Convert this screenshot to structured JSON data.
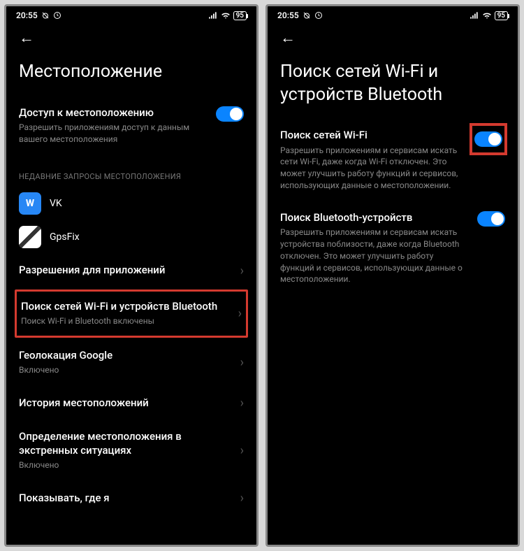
{
  "status": {
    "time": "20:55",
    "battery": "95"
  },
  "left": {
    "title": "Местоположение",
    "access": {
      "title": "Доступ к местоположению",
      "sub": "Разрешить приложениям доступ к данным вашего местоположения"
    },
    "recent_label": "НЕДАВНИЕ ЗАПРОСЫ МЕСТОПОЛОЖЕНИЯ",
    "apps": {
      "vk": "VK",
      "gpsfix": "GpsFix"
    },
    "rows": {
      "perms": "Разрешения для приложений",
      "scan_title": "Поиск сетей Wi-Fi и устройств Bluetooth",
      "scan_sub": "Поиск Wi-Fi и Bluetooth включены",
      "google": "Геолокация Google",
      "google_sub": "Включено",
      "history": "История местоположений",
      "emergency": "Определение местоположения в экстренных ситуациях",
      "emergency_sub": "Включено",
      "show": "Показывать, где я"
    }
  },
  "right": {
    "title": "Поиск сетей Wi-Fi и устройств Bluetooth",
    "wifi": {
      "title": "Поиск сетей Wi-Fi",
      "sub": "Разрешить приложениям и сервисам искать сети Wi-Fi, даже когда Wi-Fi отключен. Это может улучшить работу функций и сервисов, использующих данные о местоположении."
    },
    "bt": {
      "title": "Поиск Bluetooth-устройств",
      "sub": "Разрешить приложениям и сервисам искать устройства поблизости, даже когда Bluetooth отключен. Это может улучшить работу функций и сервисов, использующих данные о местоположении."
    }
  }
}
